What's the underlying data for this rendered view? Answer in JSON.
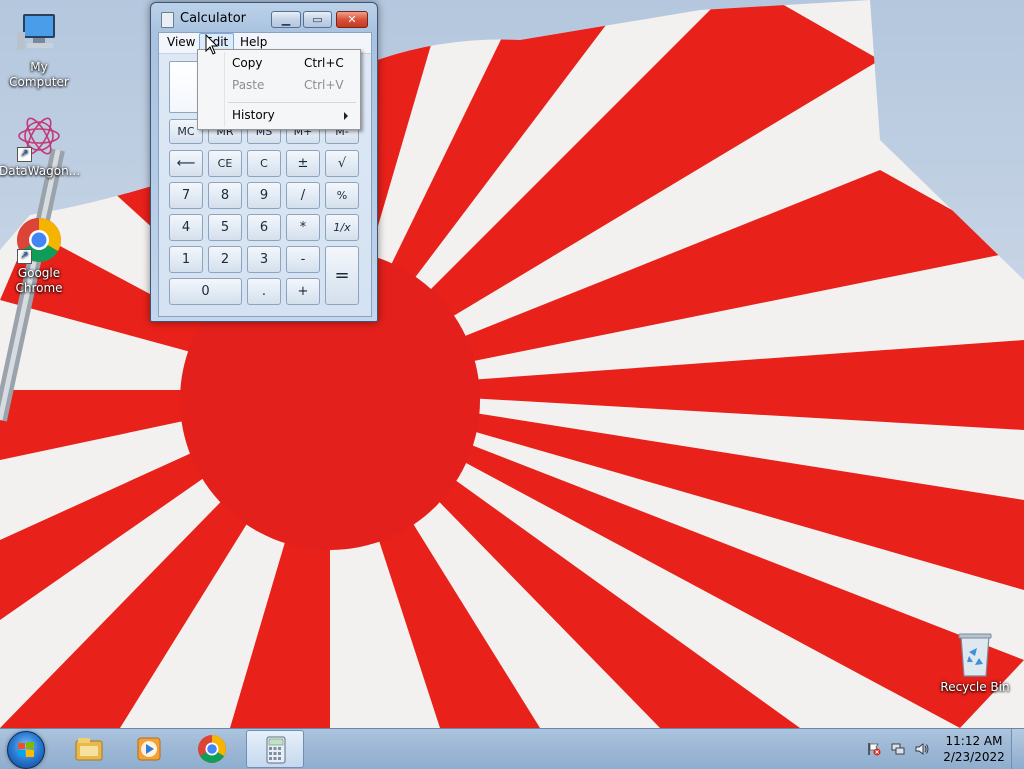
{
  "desktop": {
    "icons": [
      {
        "label": "My Computer",
        "icon": "computer-icon"
      },
      {
        "label": "DataWagon...",
        "icon": "datawagon-icon"
      },
      {
        "label": "Google Chrome",
        "icon": "chrome-icon"
      },
      {
        "label": "Recycle Bin",
        "icon": "recycle-bin-icon"
      }
    ]
  },
  "calculator": {
    "title": "Calculator",
    "menu": [
      "View",
      "Edit",
      "Help"
    ],
    "display": "",
    "memory_keys": [
      "MC",
      "MR",
      "MS",
      "M+",
      "M-"
    ],
    "keys": {
      "backspace": "⟵",
      "ce": "CE",
      "c": "C",
      "plusminus": "±",
      "sqrt": "√",
      "k7": "7",
      "k8": "8",
      "k9": "9",
      "div": "/",
      "pct": "%",
      "k4": "4",
      "k5": "5",
      "k6": "6",
      "mul": "*",
      "recip": "1/x",
      "k1": "1",
      "k2": "2",
      "k3": "3",
      "sub": "-",
      "eq": "=",
      "k0": "0",
      "dot": ".",
      "add": "+"
    }
  },
  "edit_menu": {
    "items": [
      {
        "label": "Copy",
        "shortcut": "Ctrl+C",
        "enabled": true
      },
      {
        "label": "Paste",
        "shortcut": "Ctrl+V",
        "enabled": false
      },
      {
        "label": "History",
        "shortcut": "",
        "enabled": true
      }
    ]
  },
  "taskbar": {
    "buttons": [
      "file-explorer-icon",
      "media-player-icon",
      "chrome-icon",
      "calculator-icon"
    ],
    "clock_time": "11:12 AM",
    "clock_date": "2/23/2022"
  },
  "colors": {
    "flag_red": "#e8211a",
    "sky": "#c4d3e5"
  }
}
